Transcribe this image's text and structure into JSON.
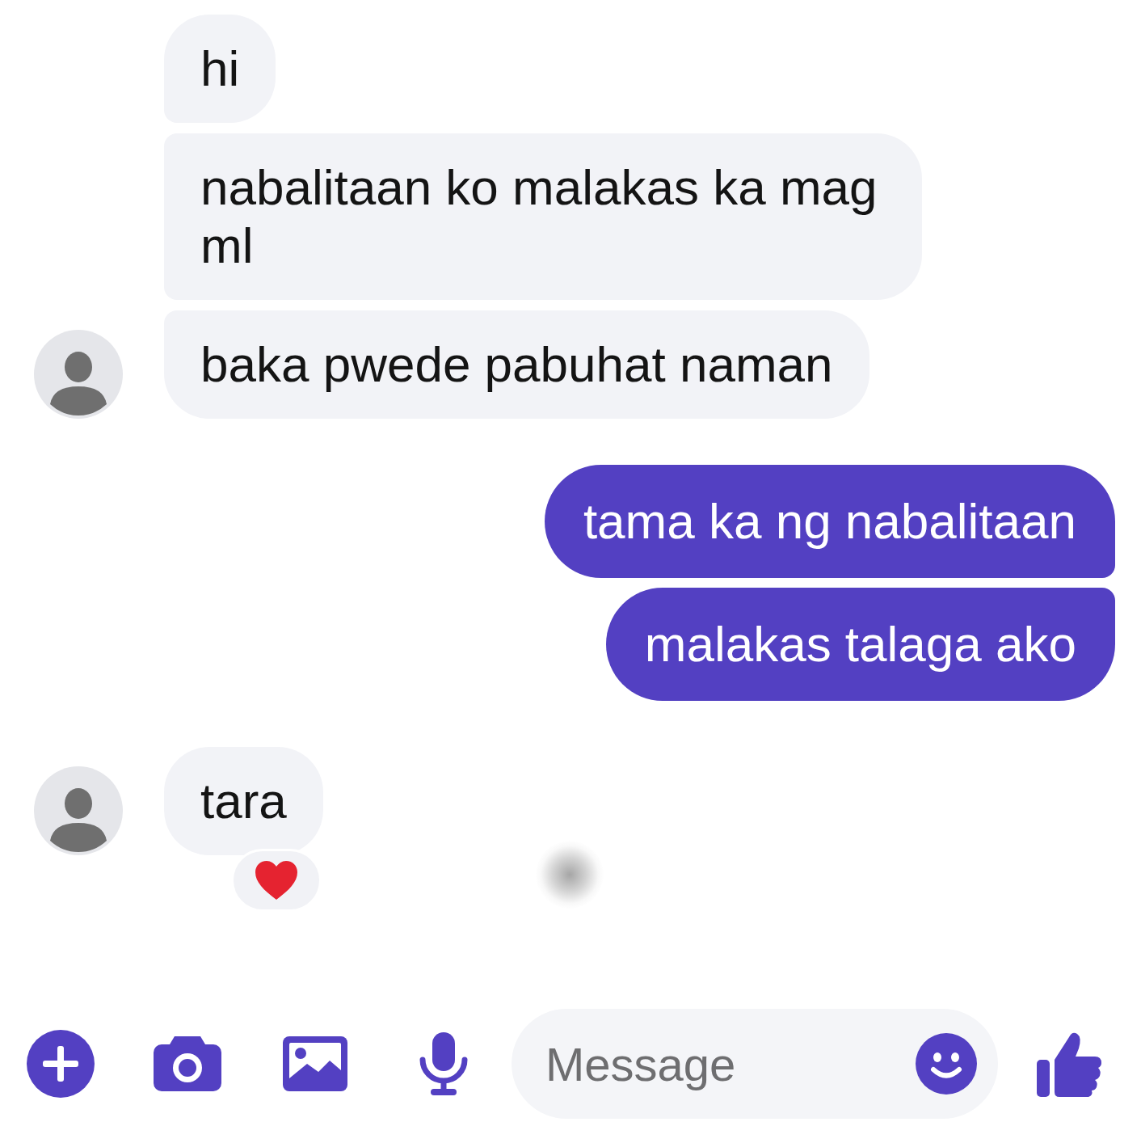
{
  "messages": [
    {
      "kind": "incoming",
      "bubbles": [
        {
          "text": "hi",
          "reacted": false
        },
        {
          "text": "nabalitaan ko malakas ka mag ml",
          "reacted": false
        },
        {
          "text": "baka pwede pabuhat naman",
          "reacted": false
        }
      ]
    },
    {
      "kind": "outgoing",
      "bubbles": [
        {
          "text": "tama ka ng nabalitaan",
          "reacted": false
        },
        {
          "text": "malakas talaga ako",
          "reacted": false
        }
      ]
    },
    {
      "kind": "incoming",
      "bubbles": [
        {
          "text": "tara",
          "reacted": true
        }
      ]
    }
  ],
  "composer": {
    "placeholder": "Message"
  }
}
